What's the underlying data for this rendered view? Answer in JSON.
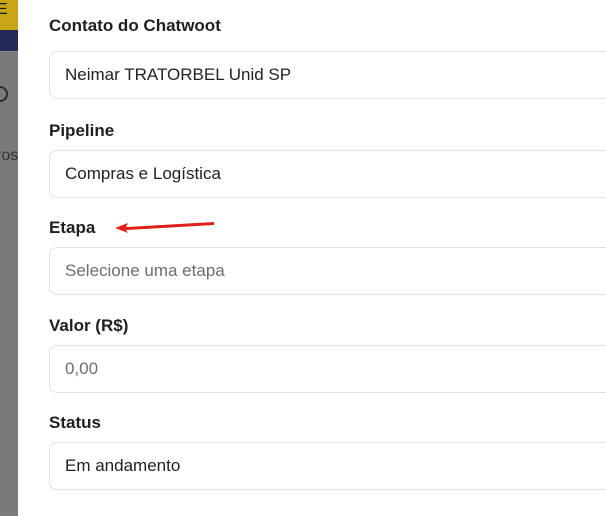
{
  "form": {
    "fields": [
      {
        "label": "Contato do Chatwoot",
        "value": "Neimar TRATORBEL Unid SP",
        "placeholder": ""
      },
      {
        "label": "Pipeline",
        "value": "Compras e Logística",
        "placeholder": ""
      },
      {
        "label": "Etapa",
        "value": "",
        "placeholder": "Selecione uma etapa"
      },
      {
        "label": "Valor (R$)",
        "value": "",
        "placeholder": "0,00"
      },
      {
        "label": "Status",
        "value": "Em andamento",
        "placeholder": ""
      }
    ]
  },
  "backdrop": {
    "edge_letter": "E",
    "edge_text": "ros"
  },
  "annotation": {
    "arrow_color": "#e0201b",
    "icon": "red-arrow-icon"
  },
  "colors": {
    "backdrop_overlay": "#7a7a7a",
    "backdrop_yellow": "#c9a416",
    "backdrop_navy": "#23285a",
    "field_border": "#e1e1e1"
  }
}
